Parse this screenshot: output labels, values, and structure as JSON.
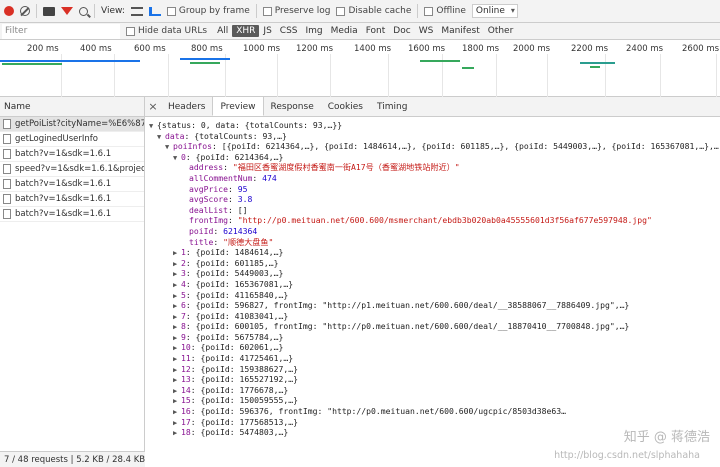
{
  "toolbar": {
    "view_label": "View:",
    "group_by_frame": "Group by frame",
    "preserve_log": "Preserve log",
    "disable_cache": "Disable cache",
    "offline": "Offline",
    "throttle": "Online"
  },
  "filterbar": {
    "filter_placeholder": "Filter",
    "hide_data_urls": "Hide data URLs",
    "types": [
      "All",
      "XHR",
      "JS",
      "CSS",
      "Img",
      "Media",
      "Font",
      "Doc",
      "WS",
      "Manifest",
      "Other"
    ],
    "active_type": "XHR"
  },
  "timeline": {
    "ticks": [
      "200 ms",
      "400 ms",
      "600 ms",
      "800 ms",
      "1000 ms",
      "1200 ms",
      "1400 ms",
      "1600 ms",
      "1800 ms",
      "2000 ms",
      "2200 ms",
      "2400 ms",
      "2600 ms"
    ],
    "colors": {
      "green": "#36a85c",
      "blue": "#1a73e8",
      "teal": "#2a9d8f"
    }
  },
  "requests": {
    "header": "Name",
    "items": [
      "getPoiList?cityName=%E6%87...",
      "getLoginedUserInfo",
      "batch?v=1&sdk=1.6.1",
      "speed?v=1&sdk=1.6.1&projec...",
      "batch?v=1&sdk=1.6.1",
      "batch?v=1&sdk=1.6.1",
      "batch?v=1&sdk=1.6.1"
    ],
    "status": "7 / 48 requests  |  5.2 KB / 28.4 KB t..."
  },
  "details": {
    "tabs": [
      "Headers",
      "Preview",
      "Response",
      "Cookies",
      "Timing"
    ],
    "active_tab": "Preview",
    "lines": [
      {
        "indent": 0,
        "arrow": "▼",
        "text": "{status: 0, data: {totalCounts: 93,…}}"
      },
      {
        "indent": 1,
        "arrow": "▼",
        "key": "data",
        "text": "{totalCounts: 93,…}"
      },
      {
        "indent": 2,
        "arrow": "▼",
        "key": "poiInfos",
        "text": "[{poiId: 6214364,…}, {poiId: 1484614,…}, {poiId: 601185,…}, {poiId: 5449003,…}, {poiId: 165367081,…},…]"
      },
      {
        "indent": 3,
        "arrow": "▼",
        "key": "0",
        "text": "{poiId: 6214364,…}"
      },
      {
        "indent": 4,
        "key": "address",
        "str": "\"福田区香蜜湖度假村香蜜南一街A17号（香蜜湖地铁站附近）\""
      },
      {
        "indent": 4,
        "key": "allCommentNum",
        "num": "474"
      },
      {
        "indent": 4,
        "key": "avgPrice",
        "num": "95"
      },
      {
        "indent": 4,
        "key": "avgScore",
        "num": "3.8"
      },
      {
        "indent": 4,
        "key": "dealList",
        "text": "[]"
      },
      {
        "indent": 4,
        "key": "frontImg",
        "str": "\"http://p0.meituan.net/600.600/msmerchant/ebdb3b020ab0a45555601d3f56af677e597948.jpg\""
      },
      {
        "indent": 4,
        "key": "poiId",
        "num": "6214364"
      },
      {
        "indent": 4,
        "key": "title",
        "str": "\"顺德大盘鱼\""
      },
      {
        "indent": 3,
        "arrow": "▶",
        "key": "1",
        "text": "{poiId: 1484614,…}"
      },
      {
        "indent": 3,
        "arrow": "▶",
        "key": "2",
        "text": "{poiId: 601185,…}"
      },
      {
        "indent": 3,
        "arrow": "▶",
        "key": "3",
        "text": "{poiId: 5449003,…}"
      },
      {
        "indent": 3,
        "arrow": "▶",
        "key": "4",
        "text": "{poiId: 165367081,…}"
      },
      {
        "indent": 3,
        "arrow": "▶",
        "key": "5",
        "text": "{poiId: 41165840,…}"
      },
      {
        "indent": 3,
        "arrow": "▶",
        "key": "6",
        "text": "{poiId: 596827, frontImg: \"http://p1.meituan.net/600.600/deal/__38588067__7886409.jpg\",…}"
      },
      {
        "indent": 3,
        "arrow": "▶",
        "key": "7",
        "text": "{poiId: 41083041,…}"
      },
      {
        "indent": 3,
        "arrow": "▶",
        "key": "8",
        "text": "{poiId: 600105, frontImg: \"http://p0.meituan.net/600.600/deal/__18870410__7700848.jpg\",…}"
      },
      {
        "indent": 3,
        "arrow": "▶",
        "key": "9",
        "text": "{poiId: 5675784,…}"
      },
      {
        "indent": 3,
        "arrow": "▶",
        "key": "10",
        "text": "{poiId: 602061,…}"
      },
      {
        "indent": 3,
        "arrow": "▶",
        "key": "11",
        "text": "{poiId: 41725461,…}"
      },
      {
        "indent": 3,
        "arrow": "▶",
        "key": "12",
        "text": "{poiId: 159388627,…}"
      },
      {
        "indent": 3,
        "arrow": "▶",
        "key": "13",
        "text": "{poiId: 165527192,…}"
      },
      {
        "indent": 3,
        "arrow": "▶",
        "key": "14",
        "text": "{poiId: 1776678,…}"
      },
      {
        "indent": 3,
        "arrow": "▶",
        "key": "15",
        "text": "{poiId: 150059555,…}"
      },
      {
        "indent": 3,
        "arrow": "▶",
        "key": "16",
        "text": "{poiId: 596376, frontImg: \"http://p0.meituan.net/600.600/ugcpic/8503d38e63…"
      },
      {
        "indent": 3,
        "arrow": "▶",
        "key": "17",
        "text": "{poiId: 177568513,…}"
      },
      {
        "indent": 3,
        "arrow": "▶",
        "key": "18",
        "text": "{poiId: 5474803,…}"
      }
    ]
  },
  "watermark": {
    "line1": "知乎 @ 蒋德浩",
    "line2": "http://blog.csdn.net/slphahaha"
  }
}
